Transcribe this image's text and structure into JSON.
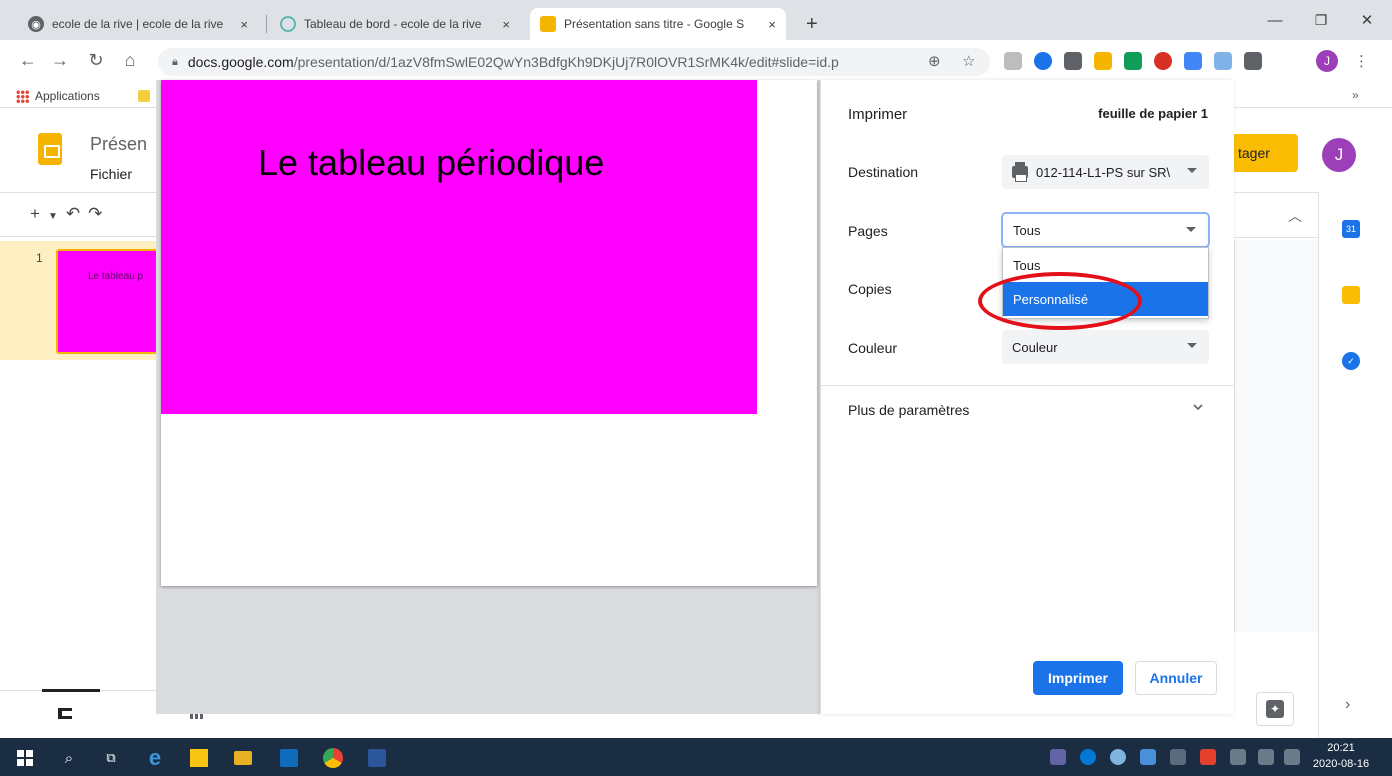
{
  "browser": {
    "tabs": [
      {
        "title": "ecole de la rive | ecole de la rive",
        "active": false
      },
      {
        "title": "Tableau de bord - ecole de la rive",
        "active": false
      },
      {
        "title": "Présentation sans titre - Google S",
        "active": true
      }
    ],
    "new_tab": "+",
    "close_glyph": "×",
    "window": {
      "minimize": "—",
      "restore": "❐",
      "close": "✕"
    },
    "url_host": "docs.google.com",
    "url_path": "/presentation/d/1azV8fmSwlE02QwYn3BdfgKh9DKjUj7R0lOVR1SrMK4k/edit#slide=id.p",
    "profile_initial": "J",
    "bookmarks_label": "Applications",
    "bookmarks_overflow": "»"
  },
  "slides_app": {
    "doc_title": "Présen",
    "menu_file": "Fichier",
    "share_label": "tager",
    "avatar_initial": "J",
    "thumbnail_number": "1",
    "thumbnail_text": "Le tableau p"
  },
  "preview": {
    "slide_title": "Le tableau périodique",
    "slide_color": "#ff00ff"
  },
  "print_dialog": {
    "title": "Imprimer",
    "sheet_count": "feuille de papier 1",
    "destination_label": "Destination",
    "destination_value": "012-114-L1-PS sur SR\\",
    "pages_label": "Pages",
    "pages_value": "Tous",
    "pages_options": [
      "Tous",
      "Personnalisé"
    ],
    "pages_highlighted": "Personnalisé",
    "copies_label": "Copies",
    "color_label": "Couleur",
    "color_value": "Couleur",
    "more_settings": "Plus de paramètres",
    "print_button": "Imprimer",
    "cancel_button": "Annuler",
    "accent_color": "#1a73e8"
  },
  "annotation": {
    "color": "#e3101a"
  },
  "taskbar": {
    "time": "20:21",
    "date": "2020-08-16"
  }
}
